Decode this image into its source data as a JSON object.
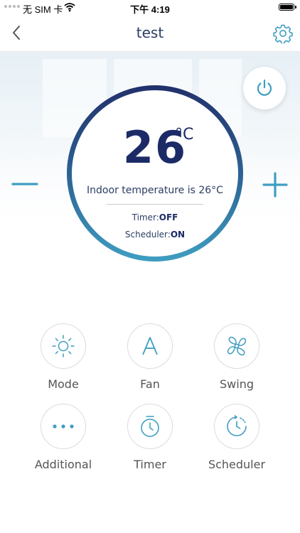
{
  "status_bar": {
    "carrier": "无 SIM 卡",
    "time": "下午 4:19"
  },
  "nav": {
    "title": "test"
  },
  "thermostat": {
    "temperature": "26",
    "unit": "°C",
    "indoor_text": "Indoor temperature is 26°C",
    "timer_label": "Timer:",
    "timer_value": "OFF",
    "scheduler_label": "Scheduler:",
    "scheduler_value": "ON"
  },
  "controls": [
    {
      "label": "Mode",
      "icon": "sun-icon"
    },
    {
      "label": "Fan",
      "icon": "letter-a-icon"
    },
    {
      "label": "Swing",
      "icon": "fan-icon"
    },
    {
      "label": "Additional",
      "icon": "more-dots-icon"
    },
    {
      "label": "Timer",
      "icon": "stopwatch-icon"
    },
    {
      "label": "Scheduler",
      "icon": "clock-schedule-icon"
    }
  ],
  "colors": {
    "accent": "#3f9ec1",
    "dark_navy": "#1c2b66"
  }
}
